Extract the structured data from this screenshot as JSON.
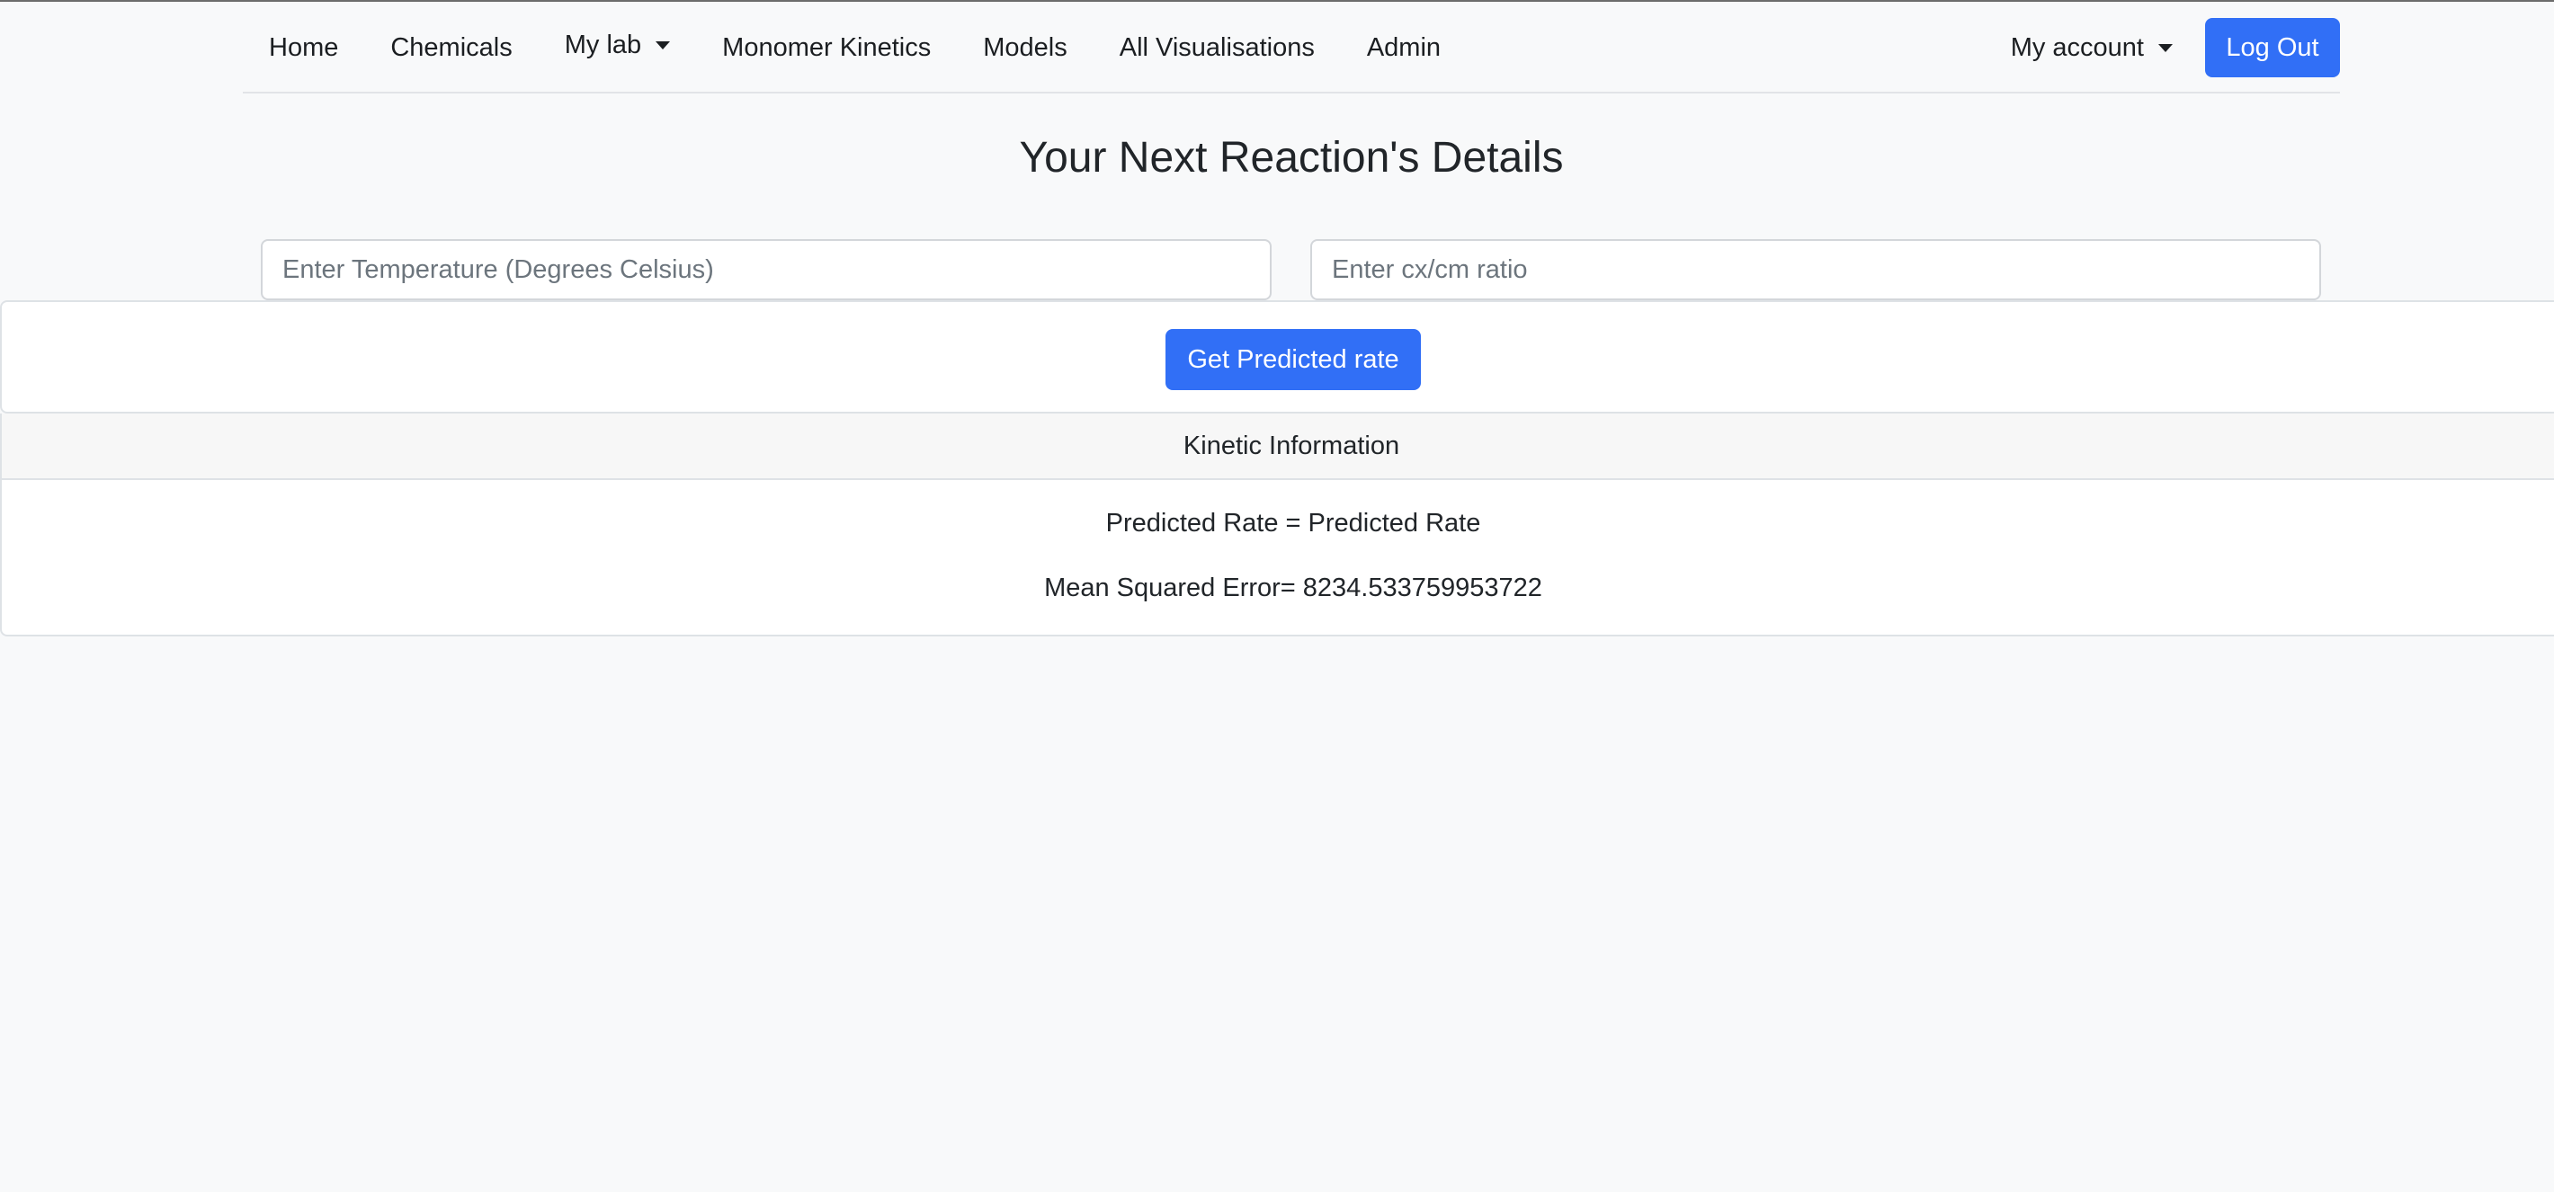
{
  "nav": {
    "items": [
      {
        "label": "Home"
      },
      {
        "label": "Chemicals"
      },
      {
        "label": "My lab"
      },
      {
        "label": "Monomer Kinetics"
      },
      {
        "label": "Models"
      },
      {
        "label": "All Visualisations"
      },
      {
        "label": "Admin"
      }
    ],
    "account_label": "My account",
    "logout_label": "Log Out"
  },
  "page": {
    "title": "Your Next Reaction's Details"
  },
  "form": {
    "temperature_placeholder": "Enter Temperature (Degrees Celsius)",
    "ratio_placeholder": "Enter cx/cm ratio",
    "submit_label": "Get Predicted rate"
  },
  "kinetic": {
    "header": "Kinetic Information",
    "predicted_rate": "Predicted Rate = Predicted Rate",
    "mean_squared_error": "Mean Squared Error= 8234.533759953722"
  },
  "colors": {
    "primary": "#316ff6",
    "background": "#f8f9fa",
    "card_header": "#f7f7f7"
  }
}
